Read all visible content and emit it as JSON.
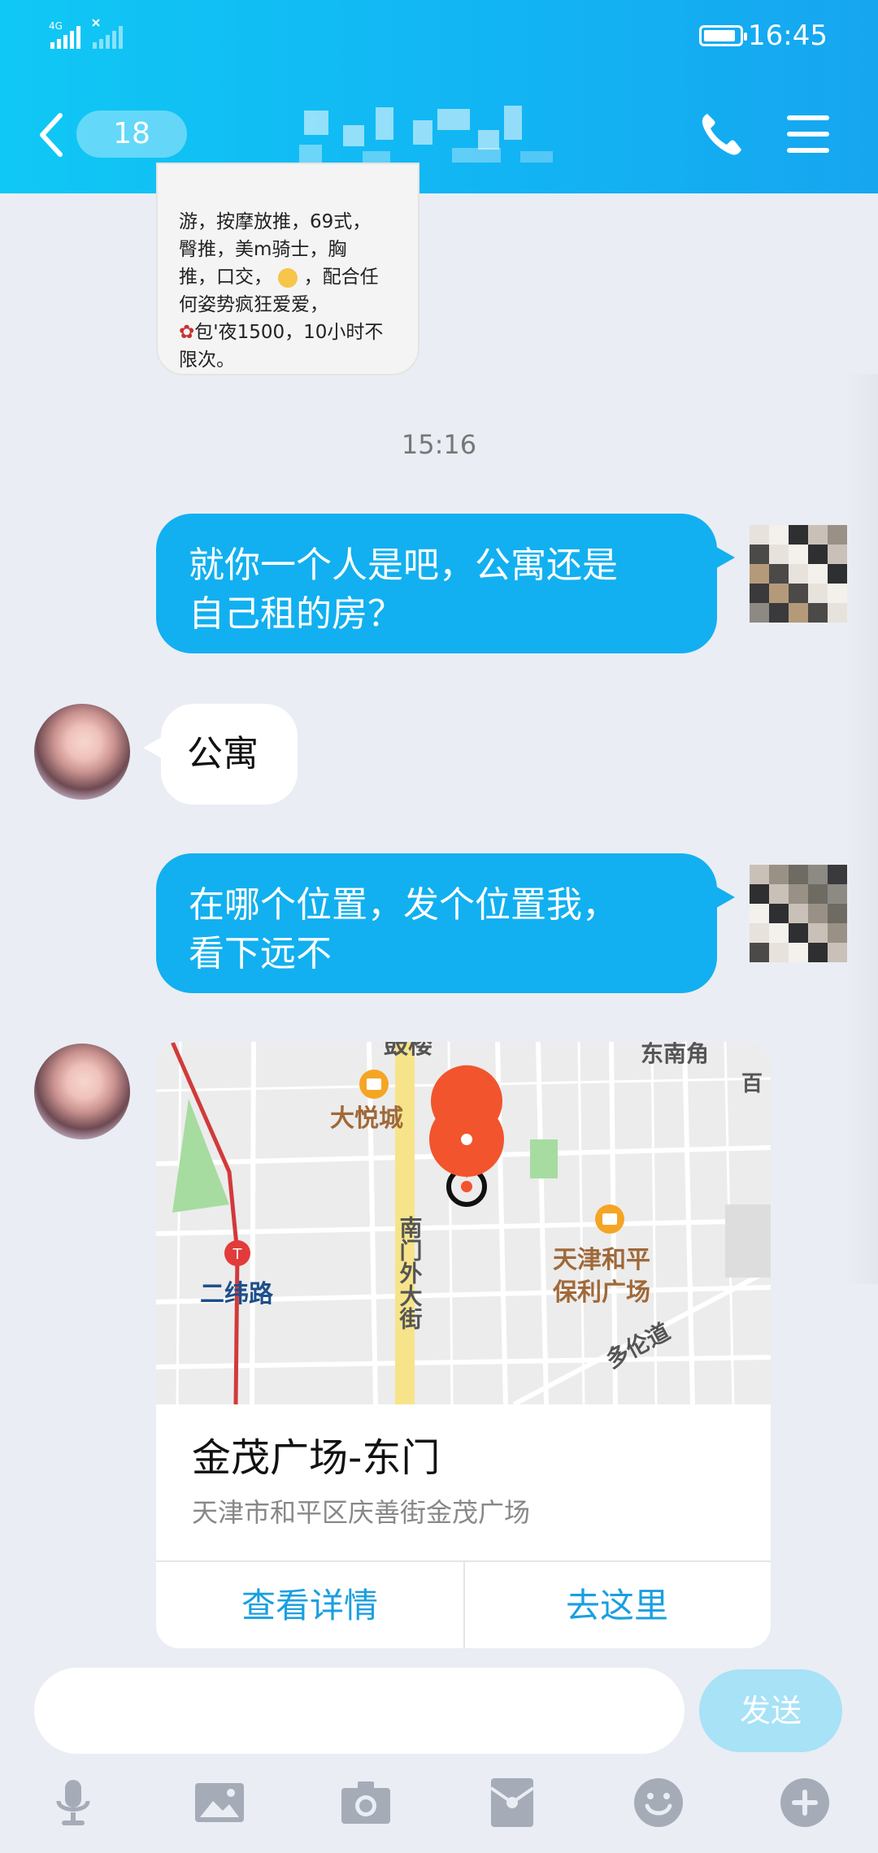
{
  "status_bar": {
    "network": "4G",
    "time": "16:45",
    "battery_level": 0.9
  },
  "header": {
    "back_label": "18",
    "contact_name": "",
    "call_icon": "phone-icon",
    "menu_icon": "menu-icon"
  },
  "messages": {
    "previous_lines": [
      "游，按摩放推，69式，",
      "臀推，美m骑士，胸",
      "推，口交，",
      "，配合任",
      "何姿势疯狂爱爱，",
      "包'夜1500，10小时不",
      "限次。"
    ],
    "time_separator": "15:16",
    "out_1_line1": "就你一个人是吧，公寓还是",
    "out_1_line2": "自己租的房？",
    "in_1": "公寓",
    "out_2_line1": "在哪个位置，发个位置我，",
    "out_2_line2": "看下远不"
  },
  "location": {
    "title": "金茂广场-东门",
    "address": "天津市和平区庆善街金茂广场",
    "view_details": "查看详情",
    "go_here": "去这里",
    "map_labels": {
      "gulou": "鼓楼",
      "dongnanjiao": "东南角",
      "dayuecheng": "大悦城",
      "nanmen": "南门外大街",
      "erweilu": "二纬路",
      "baoli_1": "天津和平",
      "baoli_2": "保利广场",
      "duolun": "多伦道",
      "edge": "百"
    }
  },
  "input_bar": {
    "placeholder": "",
    "send_label": "发送",
    "tools": [
      "microphone-icon",
      "image-icon",
      "camera-icon",
      "red-packet-icon",
      "emoji-icon",
      "plus-icon"
    ]
  },
  "colors": {
    "header": "#12b5f3",
    "out_bubble": "#12b0f0",
    "in_bubble": "#ffffff",
    "background": "#eaedf4",
    "map_pin": "#f2542d",
    "send_disabled": "#a7e2f7"
  }
}
